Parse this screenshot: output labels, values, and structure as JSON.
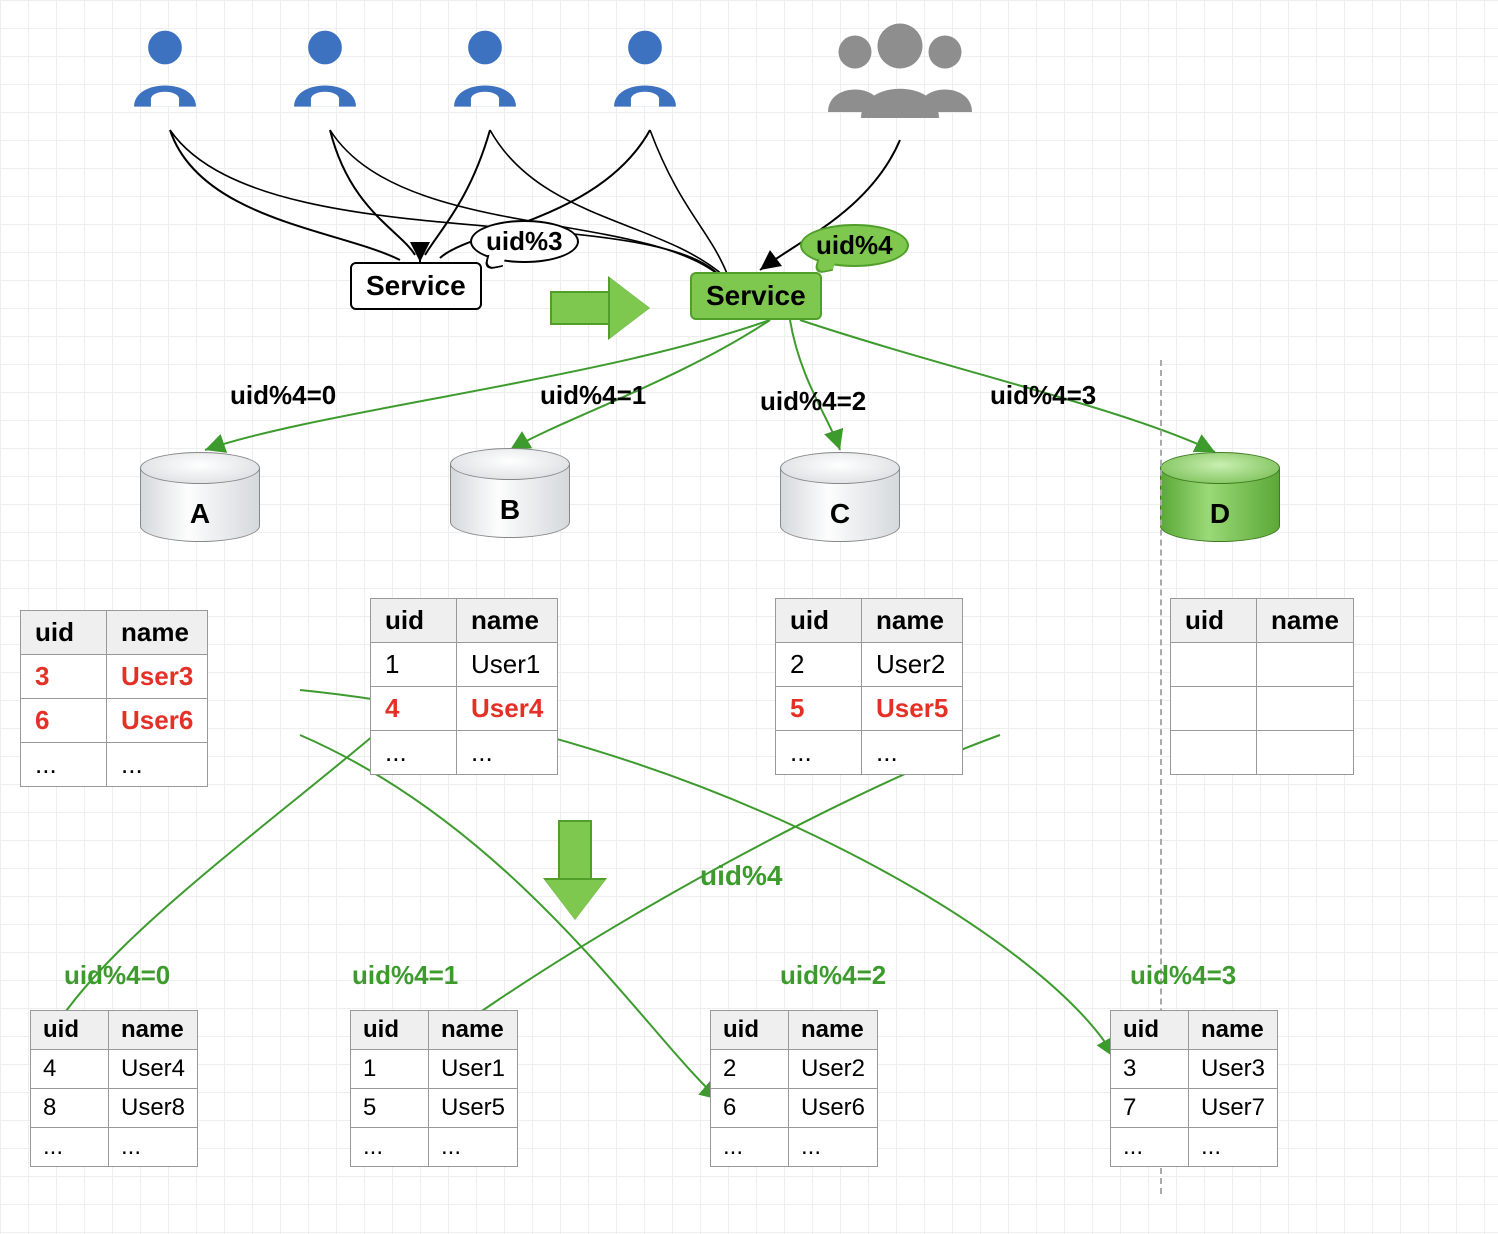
{
  "services": {
    "old_label": "Service",
    "old_bubble": "uid%3",
    "new_label": "Service",
    "new_bubble": "uid%4"
  },
  "routes_top": [
    {
      "label": "uid%4=0"
    },
    {
      "label": "uid%4=1"
    },
    {
      "label": "uid%4=2"
    },
    {
      "label": "uid%4=3"
    }
  ],
  "dbs_top": [
    {
      "label": "A"
    },
    {
      "label": "B"
    },
    {
      "label": "C"
    },
    {
      "label": "D"
    }
  ],
  "tables_top": {
    "headers": [
      "uid",
      "name"
    ],
    "A": [
      {
        "uid": "3",
        "name": "User3",
        "highlight": true
      },
      {
        "uid": "6",
        "name": "User6",
        "highlight": true
      },
      {
        "uid": "...",
        "name": "..."
      }
    ],
    "B": [
      {
        "uid": "1",
        "name": "User1"
      },
      {
        "uid": "4",
        "name": "User4",
        "highlight": true
      },
      {
        "uid": "...",
        "name": "..."
      }
    ],
    "C": [
      {
        "uid": "2",
        "name": "User2"
      },
      {
        "uid": "5",
        "name": "User5",
        "highlight": true
      },
      {
        "uid": "...",
        "name": "..."
      }
    ],
    "D": [
      {
        "uid": "",
        "name": ""
      },
      {
        "uid": "",
        "name": ""
      },
      {
        "uid": "",
        "name": ""
      }
    ]
  },
  "mid_label": "uid%4",
  "routes_bottom": [
    {
      "label": "uid%4=0"
    },
    {
      "label": "uid%4=1"
    },
    {
      "label": "uid%4=2"
    },
    {
      "label": "uid%4=3"
    }
  ],
  "tables_bottom": {
    "headers": [
      "uid",
      "name"
    ],
    "cols": [
      [
        {
          "uid": "4",
          "name": "User4"
        },
        {
          "uid": "8",
          "name": "User8"
        },
        {
          "uid": "...",
          "name": "..."
        }
      ],
      [
        {
          "uid": "1",
          "name": "User1"
        },
        {
          "uid": "5",
          "name": "User5"
        },
        {
          "uid": "...",
          "name": "..."
        }
      ],
      [
        {
          "uid": "2",
          "name": "User2"
        },
        {
          "uid": "6",
          "name": "User6"
        },
        {
          "uid": "...",
          "name": "..."
        }
      ],
      [
        {
          "uid": "3",
          "name": "User3"
        },
        {
          "uid": "7",
          "name": "User7"
        },
        {
          "uid": "...",
          "name": "..."
        }
      ]
    ]
  },
  "colors": {
    "green": "#7ec850",
    "greenDark": "#519e2b",
    "red": "#e53028",
    "blue": "#3d72c1",
    "grey": "#8e8e8e"
  }
}
